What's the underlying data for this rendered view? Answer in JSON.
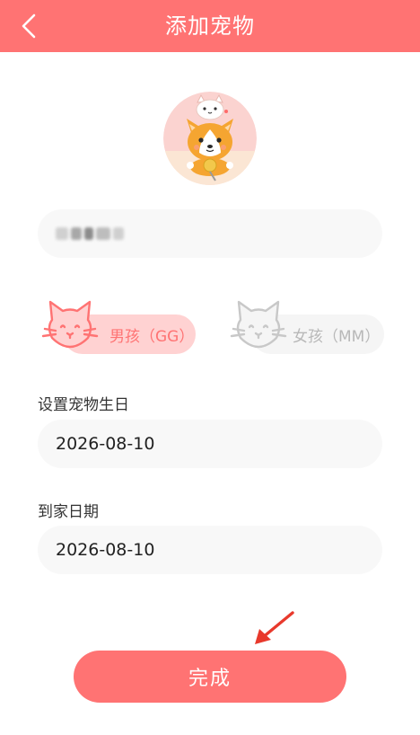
{
  "header": {
    "title": "添加宠物",
    "background": "#ff7373"
  },
  "avatar": {
    "icon": "corgi-and-kitten-avatar"
  },
  "name_field": {
    "value": "",
    "note_icon": "blurred-name-text"
  },
  "gender": {
    "male": {
      "label": "男孩（GG）",
      "selected": true,
      "icon": "cat-face-icon",
      "color": "#ff7373",
      "bg": "#ffd2d2"
    },
    "female": {
      "label": "女孩（MM）",
      "selected": false,
      "icon": "cat-face-icon",
      "color": "#c8c8c8",
      "bg": "#f5f5f5"
    }
  },
  "birthday": {
    "label": "设置宠物生日",
    "value": "2026-08-10"
  },
  "arrival": {
    "label": "到家日期",
    "value": "2026-08-10"
  },
  "submit": {
    "label": "完成"
  },
  "annotation": {
    "icon": "red-arrow-icon",
    "color": "#e8392c"
  }
}
